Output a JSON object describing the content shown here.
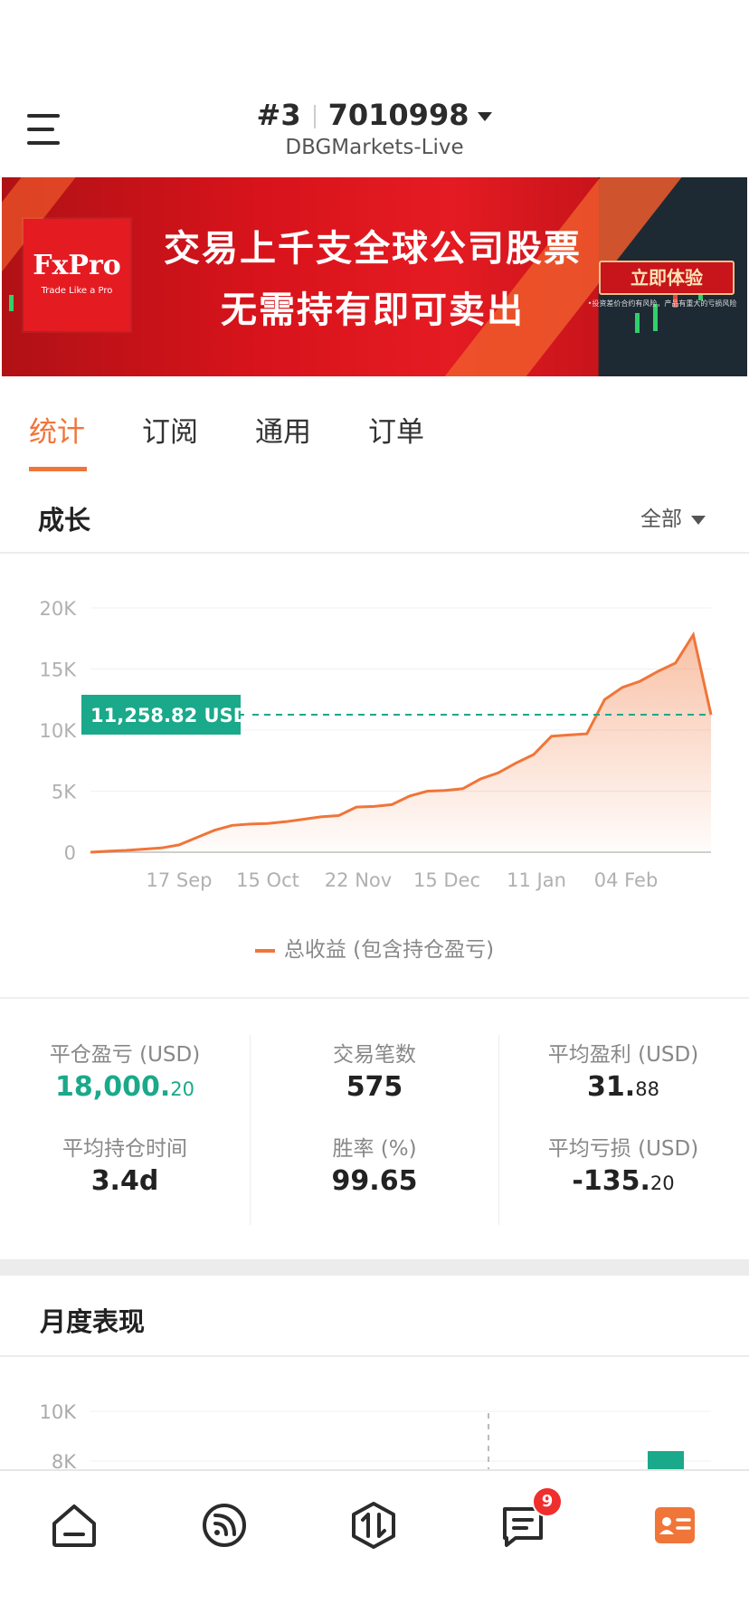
{
  "header": {
    "rank": "#3",
    "account_number": "7010998",
    "server": "DBGMarkets-Live"
  },
  "banner": {
    "brand": "FxPro",
    "brand_tagline": "Trade Like a Pro",
    "headline_line1": "交易上千支全球公司股票",
    "headline_line2": "无需持有即可卖出",
    "cta_label": "立即体验",
    "disclaimer": "•投资差价合约有风险，产品有重大的亏损风险"
  },
  "tabs": [
    {
      "label": "统计",
      "active": true
    },
    {
      "label": "订阅",
      "active": false
    },
    {
      "label": "通用",
      "active": false
    },
    {
      "label": "订单",
      "active": false
    }
  ],
  "growth": {
    "title": "成长",
    "filter_label": "全部"
  },
  "chart_data": {
    "type": "area",
    "y_ticks": [
      "20K",
      "15K",
      "10K",
      "5K",
      "0"
    ],
    "x_ticks": [
      "17 Sep",
      "15 Oct",
      "22 Nov",
      "15 Dec",
      "11 Jan",
      "04 Feb"
    ],
    "ylim": [
      0,
      20000
    ],
    "marker_label": "11,258.82 USD",
    "marker_value": 11258.82,
    "series": [
      {
        "name": "总收益 (包含持仓盈亏)",
        "color": "#f07539",
        "values": [
          0,
          80,
          150,
          250,
          350,
          600,
          1200,
          1800,
          2200,
          2300,
          2350,
          2500,
          2700,
          2900,
          3000,
          3700,
          3750,
          3900,
          4600,
          5000,
          5050,
          5200,
          6000,
          6500,
          7300,
          8000,
          9500,
          9600,
          9700,
          12500,
          13500,
          14000,
          14800,
          15500,
          17800,
          11258.82
        ]
      }
    ],
    "grid": true
  },
  "stats": {
    "closed_pnl_label": "平仓盈亏 (USD)",
    "closed_pnl_main": "18,000.",
    "closed_pnl_dec": "20",
    "trades_label": "交易笔数",
    "trades_value": "575",
    "avg_profit_label": "平均盈利 (USD)",
    "avg_profit_main": "31.",
    "avg_profit_dec": "88",
    "avg_hold_label": "平均持仓时间",
    "avg_hold_value": "3.4d",
    "win_rate_label": "胜率 (%)",
    "win_rate_value": "99.65",
    "avg_loss_label": "平均亏损 (USD)",
    "avg_loss_main": "-135.",
    "avg_loss_dec": "20"
  },
  "monthly": {
    "title": "月度表现",
    "y_ticks": [
      "10K",
      "8K"
    ]
  },
  "bottom_nav": {
    "items": [
      "home-icon",
      "feed-icon",
      "trade-icon",
      "messages-icon",
      "profile-icon"
    ],
    "message_badge": "9",
    "accent": "#f07539"
  }
}
